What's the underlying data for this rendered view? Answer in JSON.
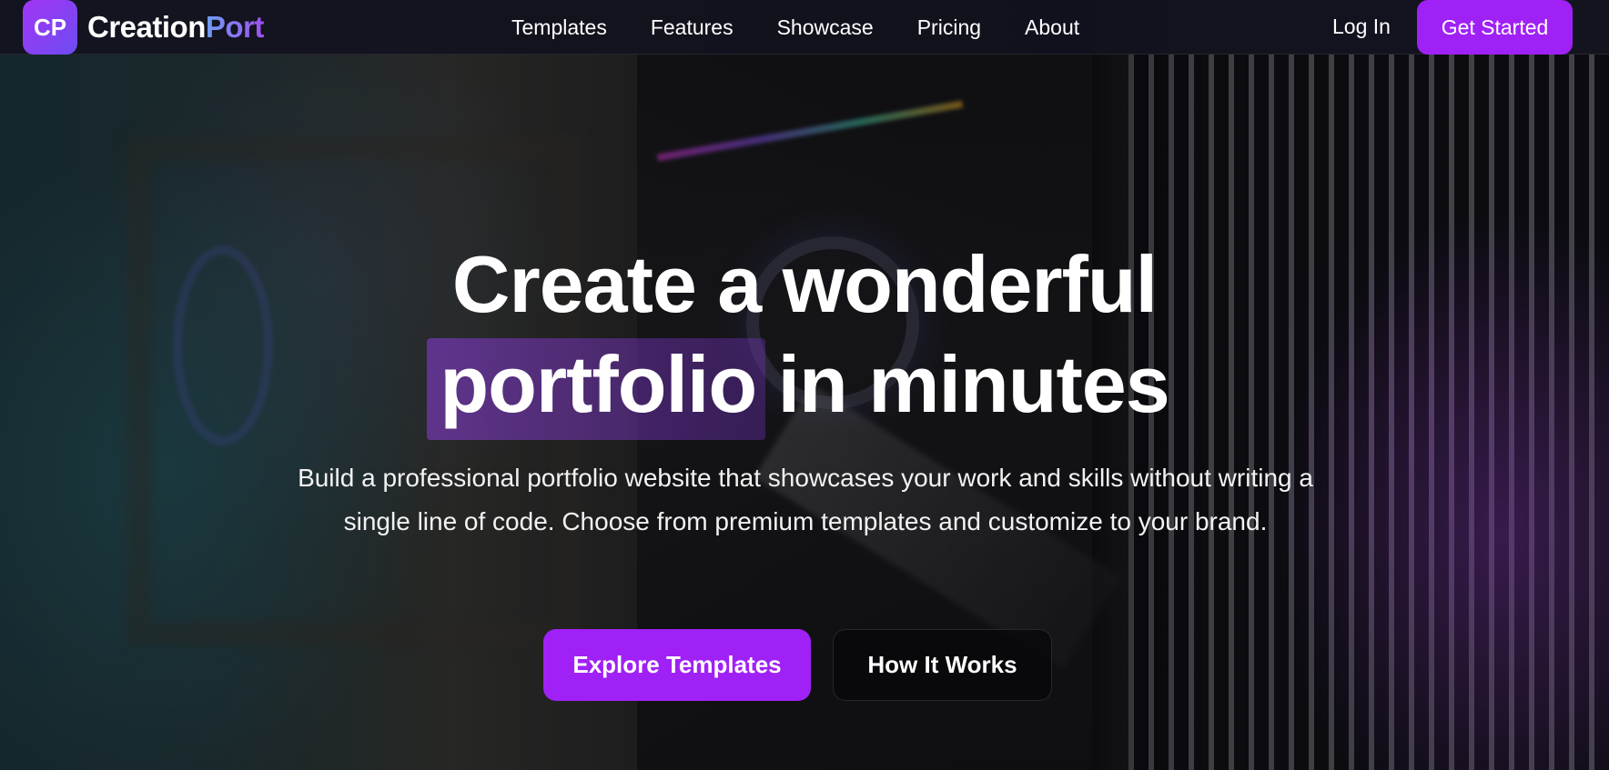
{
  "brand": {
    "badge": "CP",
    "name_part1": "Creation",
    "name_part2": "Port"
  },
  "nav": {
    "links": [
      {
        "label": "Templates"
      },
      {
        "label": "Features"
      },
      {
        "label": "Showcase"
      },
      {
        "label": "Pricing"
      },
      {
        "label": "About"
      }
    ],
    "login_label": "Log In",
    "cta_label": "Get Started"
  },
  "hero": {
    "title_line1": "Create a wonderful",
    "title_highlight": "portfolio",
    "title_rest": " in minutes",
    "subtitle": "Build a professional portfolio website that showcases your work and skills without writing a single line of code. Choose from premium templates and customize to your brand.",
    "primary_cta": "Explore Templates",
    "secondary_cta": "How It Works"
  },
  "colors": {
    "accent": "#a021f5",
    "logo_gradient_start": "#a235f6",
    "logo_gradient_end": "#6d4cf0",
    "nav_background": "#12121e"
  }
}
